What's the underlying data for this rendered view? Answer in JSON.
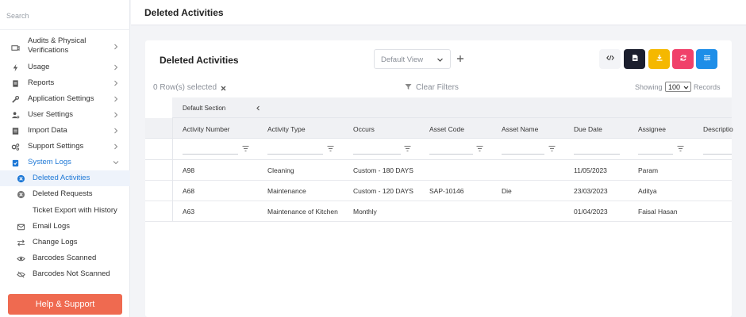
{
  "sidebar": {
    "search_placeholder": "Search",
    "items": [
      {
        "label": "Audits & Physical Verifications",
        "icon": "audit-icon"
      },
      {
        "label": "Usage",
        "icon": "lightning-icon"
      },
      {
        "label": "Reports",
        "icon": "report-icon"
      },
      {
        "label": "Application Settings",
        "icon": "wrench-icon"
      },
      {
        "label": "User Settings",
        "icon": "user-settings-icon"
      },
      {
        "label": "Import Data",
        "icon": "import-icon"
      },
      {
        "label": "Support Settings",
        "icon": "gears-icon"
      },
      {
        "label": "System Logs",
        "icon": "clipboard-icon"
      }
    ],
    "sub_items": [
      {
        "label": "Deleted Activities",
        "icon": "close-circle-icon"
      },
      {
        "label": "Deleted Requests",
        "icon": "close-circle-icon"
      },
      {
        "label": "Ticket Export with History",
        "icon": ""
      },
      {
        "label": "Email Logs",
        "icon": "email-icon"
      },
      {
        "label": "Change Logs",
        "icon": "swap-icon"
      },
      {
        "label": "Barcodes Scanned",
        "icon": "eye-icon"
      },
      {
        "label": "Barcodes Not Scanned",
        "icon": "eye-off-icon"
      }
    ],
    "help_button": "Help & Support"
  },
  "header": {
    "title": "Deleted Activities"
  },
  "card": {
    "title": "Deleted Activities",
    "view_select": "Default View",
    "rows_selected": "0 Row(s) selected",
    "clear_filters": "Clear Filters",
    "showing": "Showing",
    "records_value": "100",
    "records_label": "Records"
  },
  "colors": {
    "code_btn": "#f3f4f7",
    "pdf_btn": "#1c1f2e",
    "download_btn": "#f5b800",
    "refresh_btn": "#f0416a",
    "columns_btn": "#1e8ee8",
    "help_btn": "#ef6a50",
    "accent": "#1e78d6"
  },
  "table": {
    "section": "Default Section",
    "columns": [
      "Activity Number",
      "Activity Type",
      "Occurs",
      "Asset Code",
      "Asset Name",
      "Due Date",
      "Assignee",
      "Descriptio"
    ],
    "rows": [
      [
        "A98",
        "Cleaning",
        "Custom - 180 DAYS",
        "",
        "",
        "11/05/2023",
        "Param",
        ""
      ],
      [
        "A68",
        "Maintenance",
        "Custom - 120 DAYS",
        "SAP-10146",
        "Die",
        "23/03/2023",
        "Aditya",
        ""
      ],
      [
        "A63",
        "Maintenance of Kitchen",
        "Monthly",
        "",
        "",
        "01/04/2023",
        "Faisal Hasan",
        ""
      ]
    ]
  }
}
